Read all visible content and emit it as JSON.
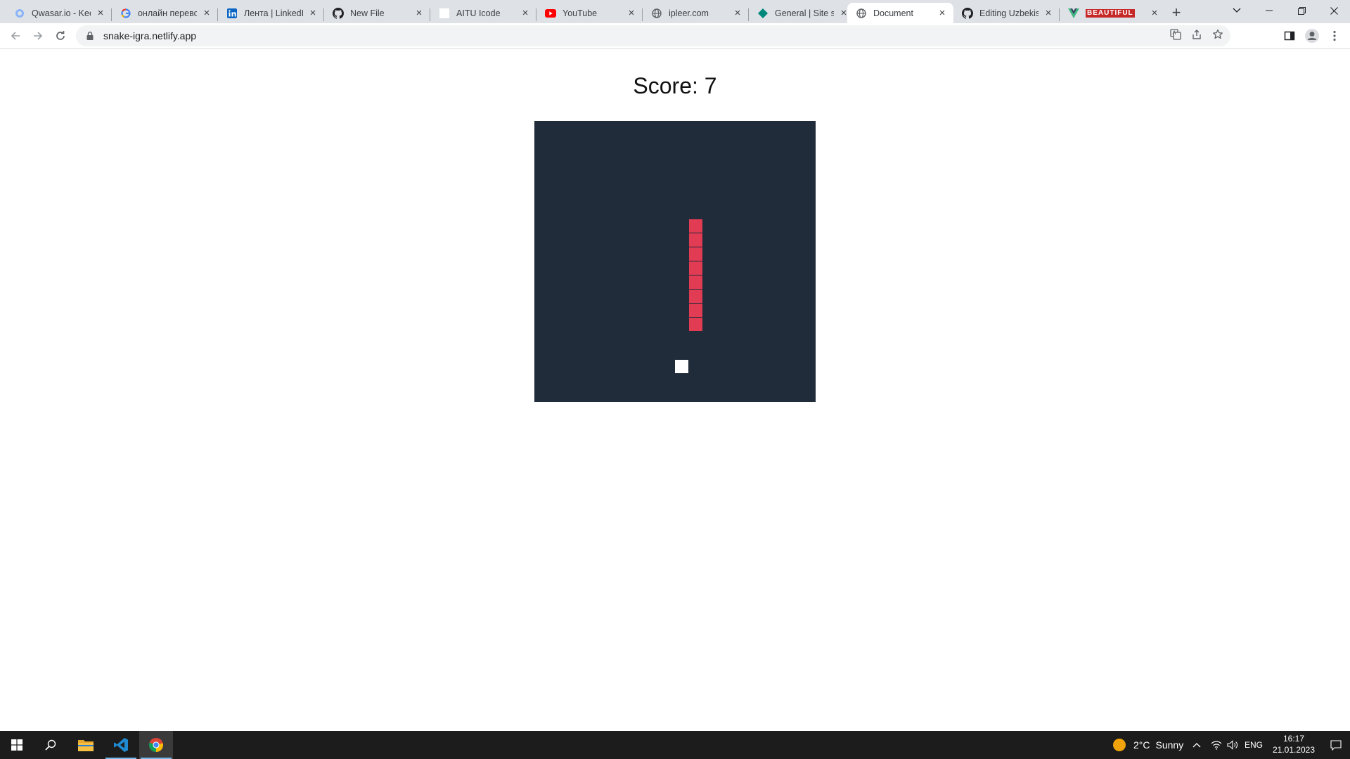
{
  "browser": {
    "tabs": [
      {
        "title": "Qwasar.io - Keep",
        "icon": "qwasar-icon"
      },
      {
        "title": "онлайн перевод",
        "icon": "google-icon"
      },
      {
        "title": "Лента | LinkedIn",
        "icon": "linkedin-icon"
      },
      {
        "title": "New File",
        "icon": "github-icon"
      },
      {
        "title": "AITU Icode",
        "icon": "blank-page-icon"
      },
      {
        "title": "YouTube",
        "icon": "youtube-icon"
      },
      {
        "title": "ipleer.com",
        "icon": "globe-icon"
      },
      {
        "title": "General | Site se",
        "icon": "diamond-icon"
      },
      {
        "title": "Document",
        "icon": "globe-icon",
        "active": true
      },
      {
        "title": "Editing Uzbekist",
        "icon": "github-icon"
      },
      {
        "title": "BEAUTIFUL",
        "icon": "vue-icon"
      }
    ],
    "url": "snake-igra.netlify.app"
  },
  "page": {
    "score_label": "Score: 7"
  },
  "game": {
    "grid_cols": 20,
    "grid_rows": 20,
    "snake": [
      [
        11,
        7
      ],
      [
        11,
        8
      ],
      [
        11,
        9
      ],
      [
        11,
        10
      ],
      [
        11,
        11
      ],
      [
        11,
        12
      ],
      [
        11,
        13
      ],
      [
        11,
        14
      ]
    ],
    "food": [
      10,
      17
    ],
    "board_color": "#212c3a",
    "snake_color": "#e23b54",
    "food_color": "#ffffff"
  },
  "taskbar": {
    "weather_temp": "2°C",
    "weather_text": "Sunny",
    "language": "ENG",
    "time": "16:17",
    "date": "21.01.2023"
  }
}
